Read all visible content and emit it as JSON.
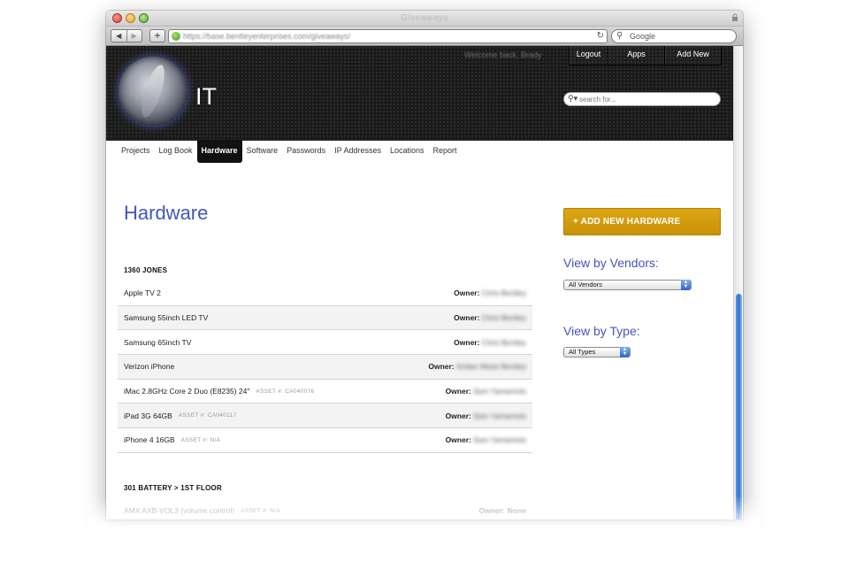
{
  "browser": {
    "window_title": "Giveaways",
    "url": "https://base.bentleyenterprises.com/giveaways/",
    "search_placeholder": "Google",
    "nav_back": "◀",
    "nav_forward": "▶",
    "add_tab": "+",
    "reload_symbol": "↻"
  },
  "header": {
    "site_title": "IT",
    "welcome": "Welcome back, Brady",
    "nav": [
      "Logout",
      "Apps",
      "Add New"
    ],
    "search_placeholder": "search for..."
  },
  "subnav": {
    "items": [
      "Projects",
      "Log Book",
      "Hardware",
      "Software",
      "Passwords",
      "IP Addresses",
      "Locations",
      "Report"
    ],
    "active": "Hardware"
  },
  "main": {
    "page_title": "Hardware",
    "sections": [
      {
        "title": "1360 JONES",
        "rows": [
          {
            "name": "Apple TV 2",
            "asset": "",
            "owner_label": "Owner:",
            "owner": "Chris Bentley"
          },
          {
            "name": "Samsung 55inch LED TV",
            "asset": "",
            "owner_label": "Owner:",
            "owner": "Chris Bentley"
          },
          {
            "name": "Samsung 65inch TV",
            "asset": "",
            "owner_label": "Owner:",
            "owner": "Chris Bentley"
          },
          {
            "name": "Verizon iPhone",
            "asset": "",
            "owner_label": "Owner:",
            "owner": "Amber Marie Bentley"
          },
          {
            "name": "iMac 2.8GHz Core 2 Duo (E8235) 24\"",
            "asset": "ASSET #: CA040076",
            "owner_label": "Owner:",
            "owner": "Sam Yamamoto"
          },
          {
            "name": "iPad 3G 64GB",
            "asset": "ASSET #: CA040117",
            "owner_label": "Owner:",
            "owner": "Sam Yamamoto"
          },
          {
            "name": "iPhone 4 16GB",
            "asset": "ASSET #: N/A",
            "owner_label": "Owner:",
            "owner": "Sam Yamamoto"
          }
        ]
      },
      {
        "title": "301 BATTERY > 1ST FLOOR",
        "rows": [
          {
            "name": "AMX AXB-VOL3 (volume control)",
            "asset": "ASSET #: N/A",
            "owner_label": "Owner:",
            "owner": "None"
          }
        ]
      }
    ]
  },
  "sidebar": {
    "add_button": "+ ADD NEW HARDWARE",
    "vendors_title": "View by Vendors:",
    "vendors_selected": "All Vendors",
    "type_title": "View by Type:",
    "type_selected": "All Types"
  },
  "colors": {
    "accent_blue": "#4455bb",
    "add_button": "#d09a0d",
    "header_bg": "#1a1a1a"
  }
}
